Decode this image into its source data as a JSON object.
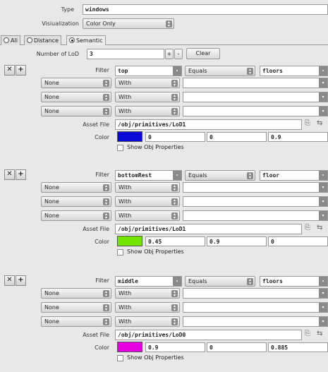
{
  "header": {
    "type_label": "Type",
    "type_value": "windows",
    "visualization_label": "Visiualization",
    "visualization_value": "Color Only"
  },
  "tabs": [
    {
      "label": "All",
      "selected": false
    },
    {
      "label": "Distance",
      "selected": false
    },
    {
      "label": "Semantic",
      "selected": true
    }
  ],
  "lod": {
    "label": "Number of LoD",
    "value": "3",
    "plus": "+",
    "minus": "-",
    "clear": "Clear"
  },
  "labels": {
    "filter": "Filter",
    "asset_file": "Asset File",
    "color": "Color",
    "show_obj": "Show Obj Properties",
    "remove_icon": "✕",
    "add_icon": "+"
  },
  "blocks": [
    {
      "filter_field": "top",
      "operator": "Equals",
      "value": "floors",
      "conditions": [
        {
          "logic": "None",
          "op": "With"
        },
        {
          "logic": "None",
          "op": "With"
        },
        {
          "logic": "None",
          "op": "With"
        }
      ],
      "asset_file": "/obj/primitives/LoD1",
      "color_hex": "#0a0ad8",
      "rgb": [
        "0",
        "0",
        "0.9"
      ]
    },
    {
      "filter_field": "bottomRest",
      "operator": "Equals",
      "value": "floor",
      "conditions": [
        {
          "logic": "None",
          "op": "With"
        },
        {
          "logic": "None",
          "op": "With"
        },
        {
          "logic": "None",
          "op": "With"
        }
      ],
      "asset_file": "/obj/primitives/LoD1",
      "color_hex": "#73e600",
      "rgb": [
        "0.45",
        "0.9",
        "0"
      ]
    },
    {
      "filter_field": "middle",
      "operator": "Equals",
      "value": "floors",
      "conditions": [
        {
          "logic": "None",
          "op": "With"
        },
        {
          "logic": "None",
          "op": "With"
        },
        {
          "logic": "None",
          "op": "With"
        }
      ],
      "asset_file": "/obj/primitives/LoD0",
      "color_hex": "#e600e1",
      "rgb": [
        "0.9",
        "0",
        "0.885"
      ]
    }
  ]
}
